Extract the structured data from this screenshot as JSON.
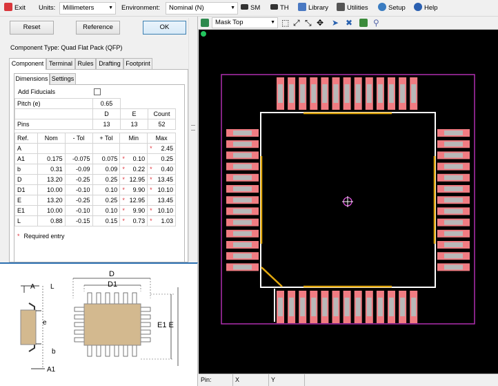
{
  "toolbar": {
    "exit_label": "Exit",
    "units_label": "Units:",
    "units_value": "Millimeters",
    "environment_label": "Environment:",
    "environment_value": "Nominal (N)",
    "sm_label": "SM",
    "th_label": "TH",
    "library_label": "Library",
    "utilities_label": "Utilities",
    "setup_label": "Setup",
    "help_label": "Help"
  },
  "actions": {
    "reset_label": "Reset",
    "reference_label": "Reference",
    "ok_label": "OK"
  },
  "component_type": "Component Type: Quad Flat Pack (QFP)",
  "tabs": [
    "Component",
    "Terminal",
    "Rules",
    "Drafting",
    "Footprint"
  ],
  "subtabs": [
    "Dimensions",
    "Settings"
  ],
  "fields": {
    "add_fiducials_label": "Add Fiducials",
    "pitch_label": "Pitch (e)",
    "pitch_value": "0.65"
  },
  "pins": {
    "header": [
      "D",
      "E",
      "Count"
    ],
    "label": "Pins",
    "values": [
      "13",
      "13",
      "52"
    ]
  },
  "dims_table": {
    "columns": [
      "Ref.",
      "Nom",
      "- Tol",
      "+ Tol",
      "Min",
      "Max"
    ],
    "rows": [
      {
        "ref": "A",
        "nom": "",
        "mtol": "",
        "ptol": "",
        "min": "",
        "max": "2.45",
        "req_min": false,
        "req_max": true
      },
      {
        "ref": "A1",
        "nom": "0.175",
        "mtol": "-0.075",
        "ptol": "0.075",
        "min": "0.10",
        "max": "0.25",
        "req_min": true,
        "req_max": false
      },
      {
        "ref": "b",
        "nom": "0.31",
        "mtol": "-0.09",
        "ptol": "0.09",
        "min": "0.22",
        "max": "0.40",
        "req_min": true,
        "req_max": true
      },
      {
        "ref": "D",
        "nom": "13.20",
        "mtol": "-0.25",
        "ptol": "0.25",
        "min": "12.95",
        "max": "13.45",
        "req_min": true,
        "req_max": true
      },
      {
        "ref": "D1",
        "nom": "10.00",
        "mtol": "-0.10",
        "ptol": "0.10",
        "min": "9.90",
        "max": "10.10",
        "req_min": true,
        "req_max": true
      },
      {
        "ref": "E",
        "nom": "13.20",
        "mtol": "-0.25",
        "ptol": "0.25",
        "min": "12.95",
        "max": "13.45",
        "req_min": true,
        "req_max": false
      },
      {
        "ref": "E1",
        "nom": "10.00",
        "mtol": "-0.10",
        "ptol": "0.10",
        "min": "9.90",
        "max": "10.10",
        "req_min": true,
        "req_max": true
      },
      {
        "ref": "L",
        "nom": "0.88",
        "mtol": "-0.15",
        "ptol": "0.15",
        "min": "0.73",
        "max": "1.03",
        "req_min": true,
        "req_max": true
      }
    ],
    "required_note": "Required entry"
  },
  "diagram": {
    "label_a": "A",
    "label_l": "L",
    "label_e": "e",
    "label_b": "b",
    "label_a1": "A1",
    "label_d": "D",
    "label_d1": "D1",
    "label_e1e": "E1 E"
  },
  "viewer": {
    "layer_value": "Mask Top"
  },
  "status": {
    "pin_label": "Pin:",
    "x_label": "X",
    "y_label": "Y"
  },
  "colors": {
    "pad": "#f07c82",
    "pad_label": "#b8b8b8",
    "outline": "#ffffff",
    "assembly_outline": "#b02fb0",
    "pin1_marker": "#e2a80e",
    "accent": "#2b6fb0"
  }
}
